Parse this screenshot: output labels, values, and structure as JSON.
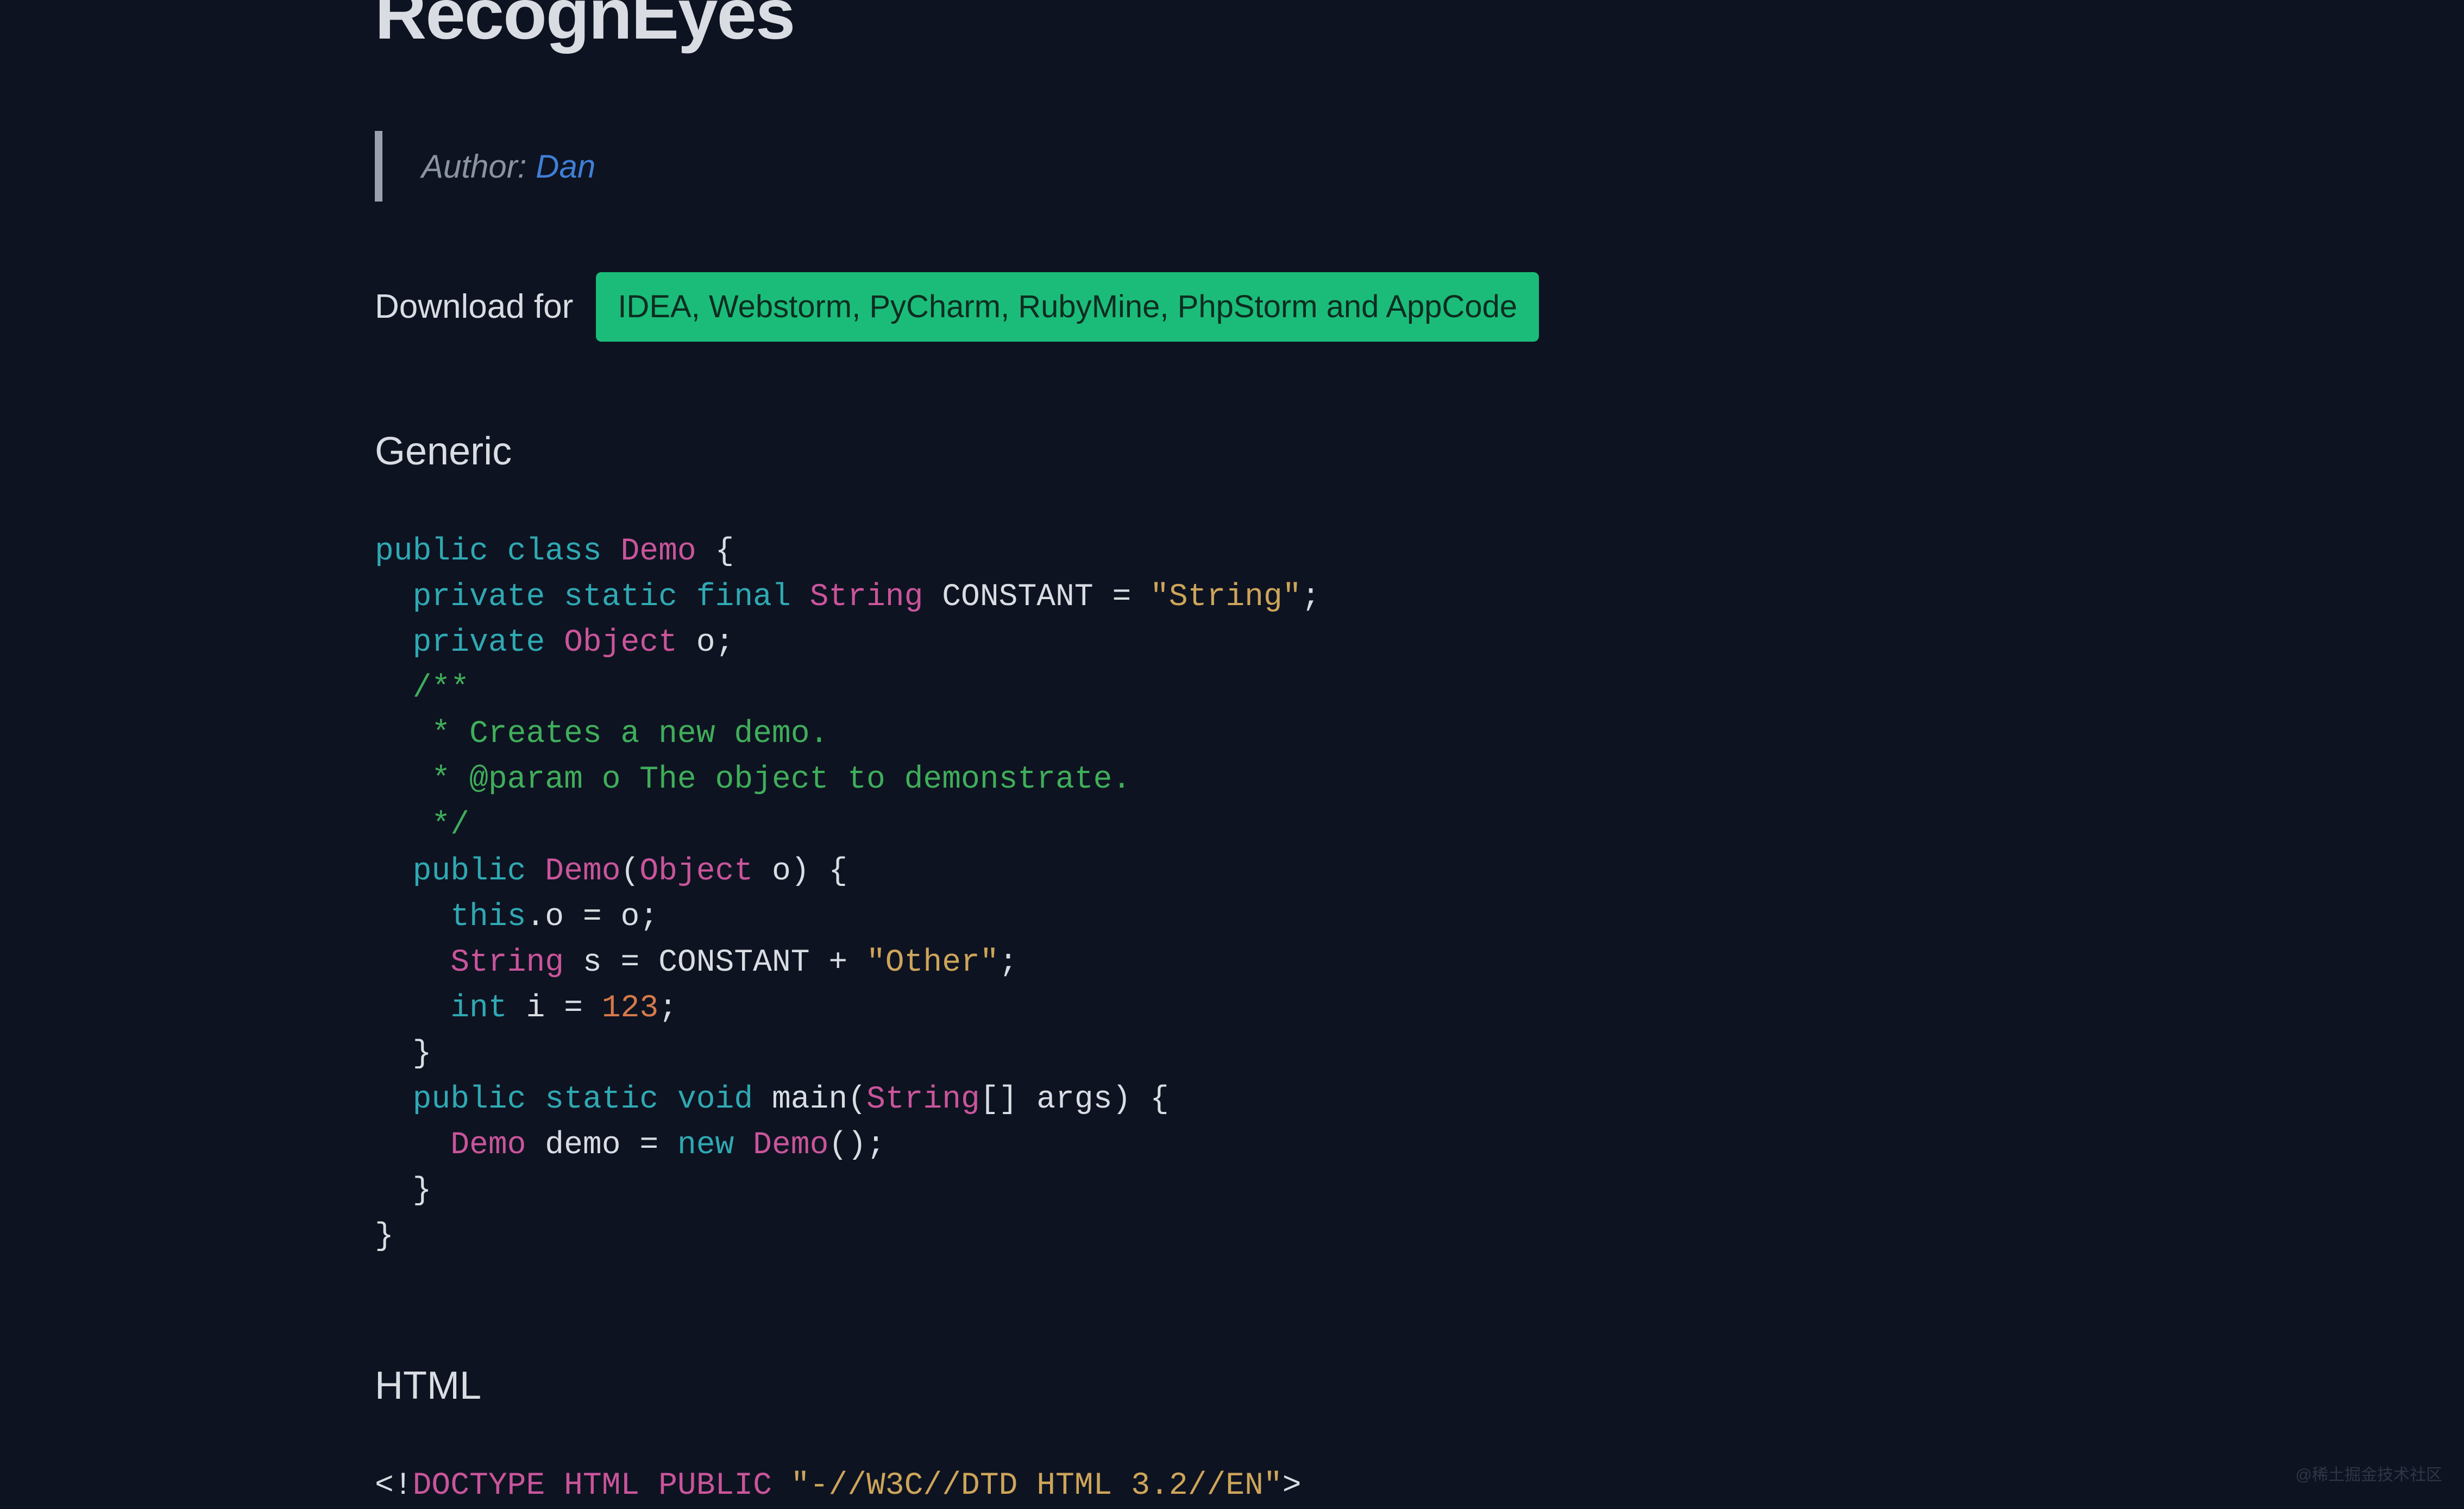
{
  "title": "RecognEyes",
  "author_prefix": "Author: ",
  "author_name": "Dan",
  "download_label": "Download for",
  "download_button": "IDEA, Webstorm, PyCharm, RubyMine, PhpStorm and AppCode",
  "sections": {
    "generic_heading": "Generic",
    "html_heading": "HTML"
  },
  "code_generic": {
    "l1": {
      "kw1": "public",
      "kw2": "class",
      "type": "Demo",
      "brace": " {"
    },
    "l2": {
      "indent": "  ",
      "kw1": "private",
      "kw2": "static",
      "kw3": "final",
      "type": "String",
      "name": " CONSTANT ",
      "eq": "= ",
      "str": "\"String\"",
      "semi": ";"
    },
    "l3": {
      "indent": "  ",
      "kw1": "private",
      "type": "Object",
      "name": " o",
      "semi": ";"
    },
    "l4": {
      "indent": "  ",
      "text": "/**"
    },
    "l5": {
      "indent": "   ",
      "text": "* Creates a new demo."
    },
    "l6": {
      "indent": "   ",
      "star": "* ",
      "tag": "@param",
      "rest": " o The object to demonstrate."
    },
    "l7": {
      "indent": "   ",
      "text": "*/"
    },
    "l8": {
      "indent": "  ",
      "kw1": "public",
      "type": "Demo",
      "paren_o": "(",
      "ptype": "Object",
      "pname": " o",
      "paren_c": ") {"
    },
    "l9": {
      "indent": "    ",
      "kw1": "this",
      "rest": ".o = o;"
    },
    "l10": {
      "indent": "    ",
      "type": "String",
      "name": " s ",
      "eq": "= CONSTANT + ",
      "str": "\"Other\"",
      "semi": ";"
    },
    "l11": {
      "indent": "    ",
      "kw1": "int",
      "name": " i ",
      "eq": "= ",
      "num": "123",
      "semi": ";"
    },
    "l12": {
      "indent": "  ",
      "text": "}"
    },
    "l13": {
      "indent": "  ",
      "kw1": "public",
      "kw2": "static",
      "kw3": "void",
      "name": " main",
      "paren_o": "(",
      "ptype": "String",
      "arr": "[] args",
      "paren_c": ") {"
    },
    "l14": {
      "indent": "    ",
      "type1": "Demo",
      "name": " demo ",
      "eq": "= ",
      "kw1": "new",
      "type2": " Demo",
      "rest": "();"
    },
    "l15": {
      "indent": "  ",
      "text": "}"
    },
    "l16": {
      "text": "}"
    }
  },
  "code_html": {
    "l1": {
      "open": "<!",
      "kw1": "DOCTYPE",
      "sp1": " ",
      "kw2": "HTML",
      "sp2": " ",
      "kw3": "PUBLIC",
      "sp3": " ",
      "str": "\"-//W3C//DTD HTML 3.2//EN\"",
      "close": ">"
    }
  },
  "watermark": "@稀土掘金技术社区"
}
